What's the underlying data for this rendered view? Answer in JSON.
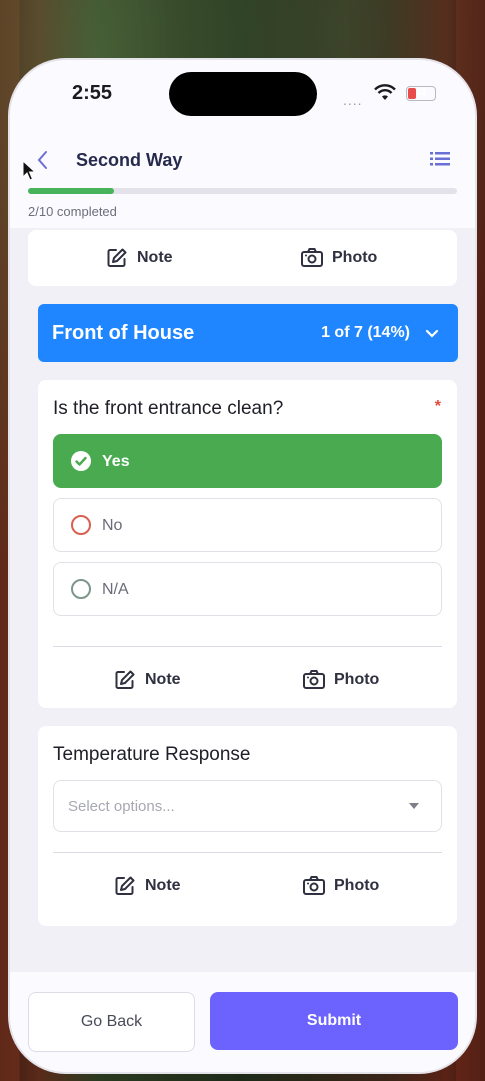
{
  "status_bar": {
    "time": "2:55",
    "signal": "....",
    "battery": "13"
  },
  "nav": {
    "title": "Second Way"
  },
  "progress": {
    "fraction": 0.2,
    "text": "2/10 completed"
  },
  "top_actions": {
    "note": "Note",
    "photo": "Photo"
  },
  "section": {
    "title": "Front of House",
    "count": "1 of 7 (14%)"
  },
  "question1": {
    "text": "Is the front entrance clean?",
    "required_mark": "*",
    "options": [
      {
        "label": "Yes",
        "selected": true
      },
      {
        "label": "No",
        "selected": false
      },
      {
        "label": "N/A",
        "selected": false
      }
    ],
    "note": "Note",
    "photo": "Photo"
  },
  "question2": {
    "text": "Temperature Response",
    "placeholder": "Select options...",
    "note": "Note",
    "photo": "Photo"
  },
  "footer": {
    "back_label": "Go Back",
    "submit_label": "Submit"
  },
  "colors": {
    "accent": "#6c63ff",
    "section": "#1f86ff",
    "success": "#4aaa50",
    "no_radio": "#d9604f",
    "na_radio": "#7d968a"
  }
}
